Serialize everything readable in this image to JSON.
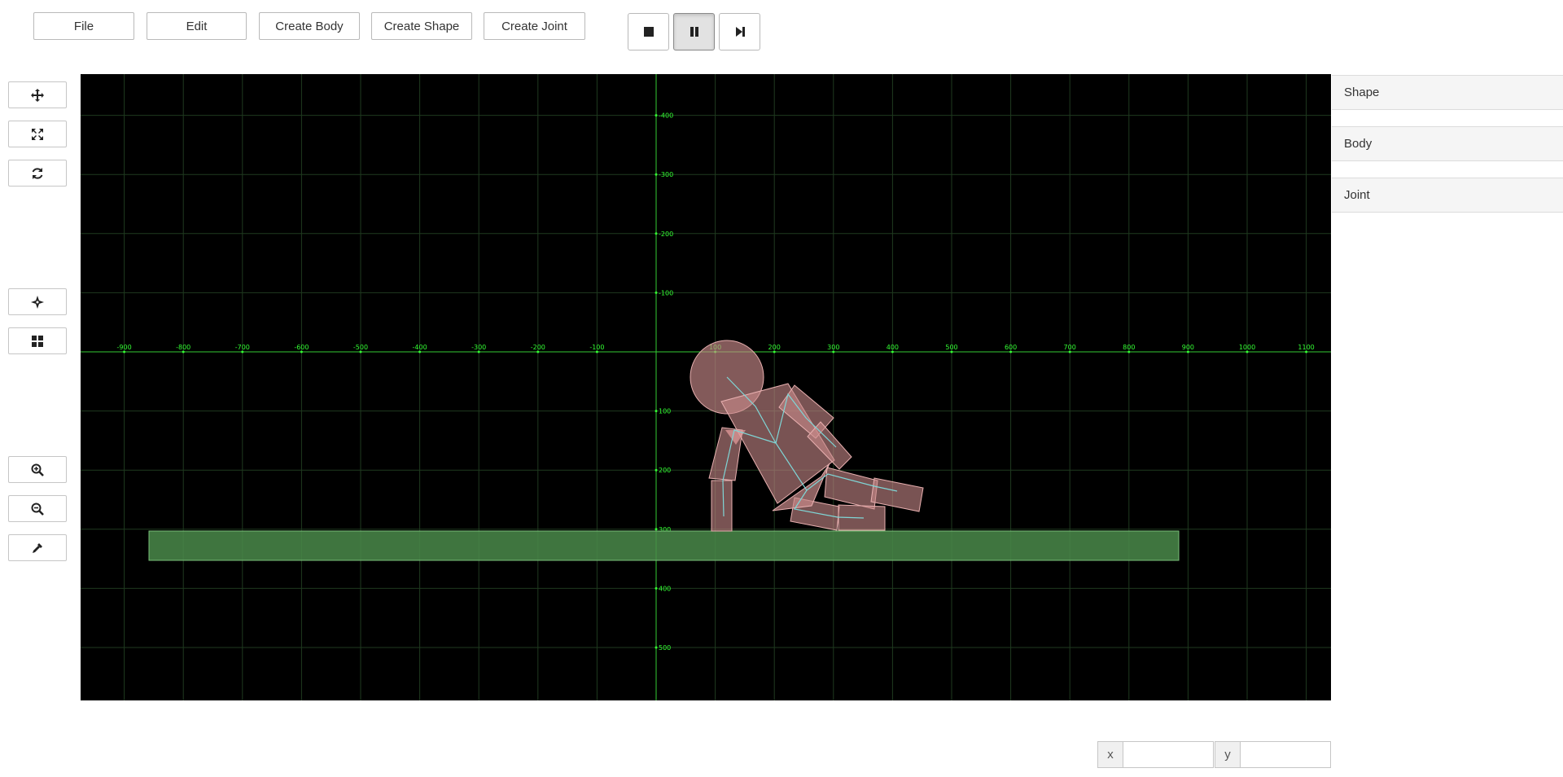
{
  "menu": {
    "file": "File",
    "edit": "Edit",
    "create_body": "Create Body",
    "create_shape": "Create Shape",
    "create_joint": "Create Joint"
  },
  "playback": {
    "stop_icon": "stop-icon",
    "pause_icon": "pause-icon",
    "step_icon": "step-forward-icon",
    "active": "pause"
  },
  "tools": [
    {
      "name": "move-tool",
      "icon": "move-arrows-icon"
    },
    {
      "name": "fit-view-tool",
      "icon": "expand-icon"
    },
    {
      "name": "reset-tool",
      "icon": "refresh-icon"
    },
    {
      "name": "center-tool",
      "icon": "crosshair-icon"
    },
    {
      "name": "grid-tool",
      "icon": "grid-icon"
    },
    {
      "name": "zoom-in-tool",
      "icon": "zoom-in-icon"
    },
    {
      "name": "zoom-out-tool",
      "icon": "zoom-out-icon"
    },
    {
      "name": "eyedropper-tool",
      "icon": "eyedropper-icon"
    }
  ],
  "panel": {
    "shape": "Shape",
    "body": "Body",
    "joint": "Joint"
  },
  "coords": {
    "x_label": "x",
    "y_label": "y",
    "x_value": "",
    "y_value": ""
  },
  "axis": {
    "x_ticks": [
      "-900",
      "-800",
      "-700",
      "-600",
      "-500",
      "-400",
      "-300",
      "-200",
      "-100",
      "100",
      "200",
      "300",
      "400",
      "500",
      "600",
      "700",
      "800",
      "900",
      "1000",
      "1100"
    ],
    "y_ticks": [
      "-400",
      "-300",
      "-200",
      "-100",
      "100",
      "200",
      "300",
      "400",
      "500"
    ]
  },
  "colors": {
    "canvas_bg": "#000000",
    "grid": "#1f3a1f",
    "axis": "#33cc33",
    "ground_fill": "#4a8a4a",
    "body_fill": "#c98a8a",
    "joint_line": "#7fd6d6"
  }
}
